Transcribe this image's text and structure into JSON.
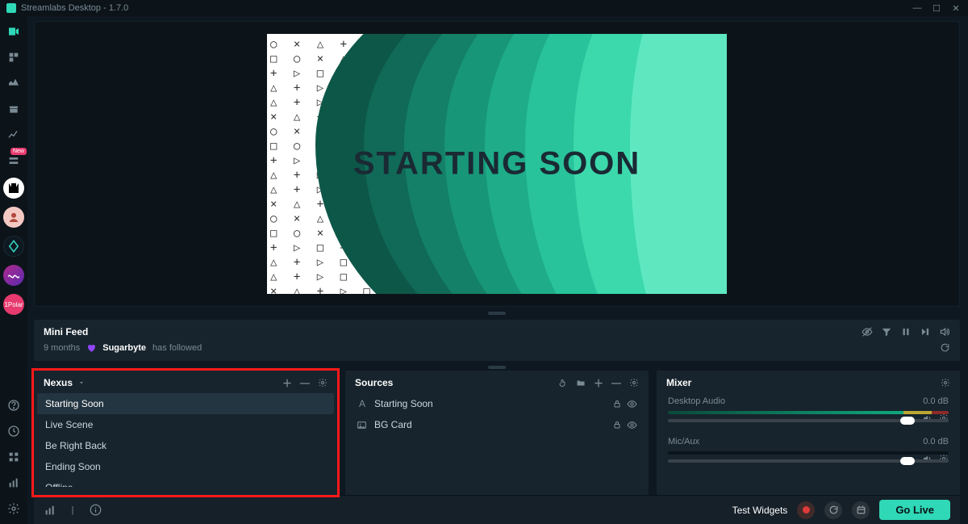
{
  "window": {
    "title": "Streamlabs Desktop - 1.7.0"
  },
  "rail_badge": "New",
  "preview": {
    "banner_text": "STARTING SOON"
  },
  "mini_feed": {
    "title": "Mini Feed",
    "items": [
      {
        "age": "9 months",
        "name": "Sugarbyte",
        "action": "has followed"
      }
    ]
  },
  "scenes": {
    "collection": "Nexus",
    "items": [
      "Starting Soon",
      "Live Scene",
      "Be Right Back",
      "Ending Soon",
      "Offline"
    ],
    "selected_index": 0
  },
  "sources": {
    "title": "Sources",
    "items": [
      {
        "icon": "A",
        "label": "Starting Soon"
      },
      {
        "icon": "img",
        "label": "BG Card"
      }
    ]
  },
  "mixer": {
    "title": "Mixer",
    "channels": [
      {
        "name": "Desktop Audio",
        "db": "0.0 dB",
        "meter": true
      },
      {
        "name": "Mic/Aux",
        "db": "0.0 dB",
        "meter": false
      }
    ]
  },
  "footer": {
    "test_widgets": "Test Widgets",
    "go_live": "Go Live"
  }
}
